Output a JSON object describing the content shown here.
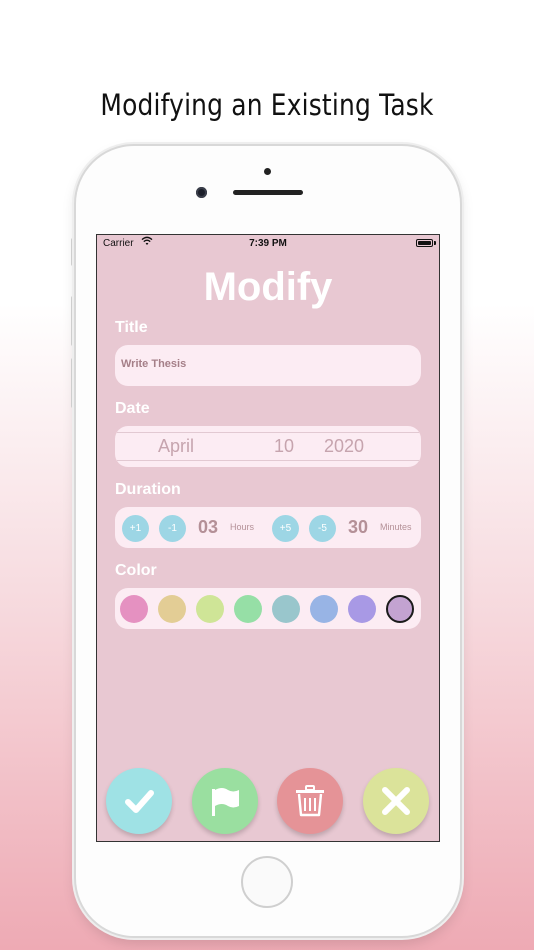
{
  "caption": "Modifying an Existing Task",
  "status_bar": {
    "carrier": "Carrier",
    "time": "7:39 PM"
  },
  "screen": {
    "title": "Modify",
    "labels": {
      "title": "Title",
      "date": "Date",
      "duration": "Duration",
      "color": "Color"
    },
    "task_title": "Write Thesis",
    "date": {
      "month": "April",
      "day": "10",
      "year": "2020"
    },
    "duration": {
      "hours_plus": "+1",
      "hours_minus": "-1",
      "hours": "03",
      "hours_unit": "Hours",
      "minutes_plus": "+5",
      "minutes_minus": "-5",
      "minutes": "30",
      "minutes_unit": "Minutes"
    },
    "colors": [
      "#e591c1",
      "#e3cd95",
      "#cfe597",
      "#96dfa6",
      "#99c6cc",
      "#98b4e5",
      "#a899e5",
      "#c3a3d1"
    ],
    "selected_color_index": 7,
    "actions": [
      {
        "name": "confirm",
        "icon": "check-icon",
        "color": "#9fe2e5"
      },
      {
        "name": "flag",
        "icon": "flag-icon",
        "color": "#9adfa0"
      },
      {
        "name": "delete",
        "icon": "trash-icon",
        "color": "#e59397"
      },
      {
        "name": "cancel",
        "icon": "close-icon",
        "color": "#dbe39a"
      }
    ]
  }
}
